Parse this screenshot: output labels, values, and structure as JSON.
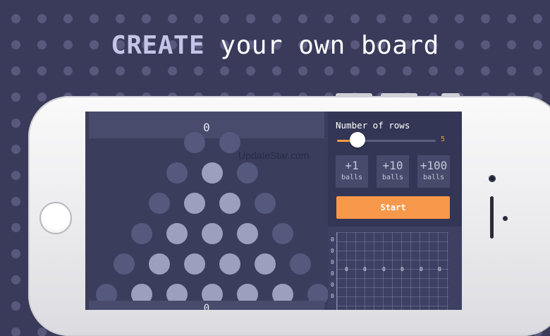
{
  "headline": {
    "strong": "CREATE",
    "rest": " your own board"
  },
  "board": {
    "top_count": "0",
    "bottom_count": "0",
    "watermark": "UpdateStar.com"
  },
  "panel": {
    "rows_label": "Number of rows",
    "rows_value": 5,
    "rows_value_text": "5",
    "rows_min": 1,
    "rows_max": 20,
    "add_buttons": [
      {
        "amount": "+1",
        "unit": "balls"
      },
      {
        "amount": "+10",
        "unit": "balls"
      },
      {
        "amount": "+100",
        "unit": "balls"
      }
    ],
    "start_label": "Start"
  },
  "histogram": {
    "y_ticks": [
      "0",
      "0",
      "0",
      "0",
      "0",
      "0"
    ],
    "bin_values": [
      "0",
      "0",
      "0",
      "0",
      "0",
      "0"
    ]
  },
  "colors": {
    "accent": "#f7984a",
    "background": "#3a3a5a",
    "peg_active": "#9c9fbd",
    "peg_inactive": "#55597d"
  }
}
